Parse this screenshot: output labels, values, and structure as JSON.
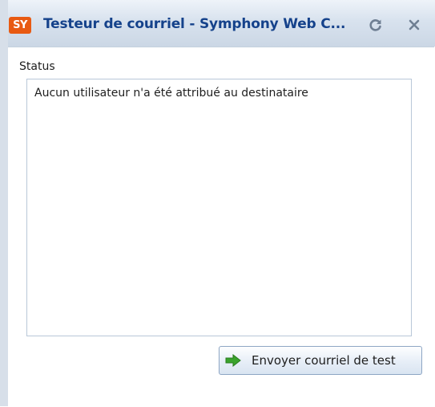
{
  "window": {
    "logo_text": "SY",
    "title": "Testeur de courriel - Symphony Web C...",
    "refresh_icon": "refresh-icon",
    "close_icon": "close-icon"
  },
  "status": {
    "label": "Status",
    "message": "Aucun utilisateur n'a été attribué au destinataire"
  },
  "actions": {
    "send_test_label": "Envoyer courriel de test",
    "send_icon": "green-arrow-right-icon"
  },
  "colors": {
    "title_text": "#15428b",
    "logo_bg": "#e85a12",
    "arrow": "#3aa32c"
  }
}
